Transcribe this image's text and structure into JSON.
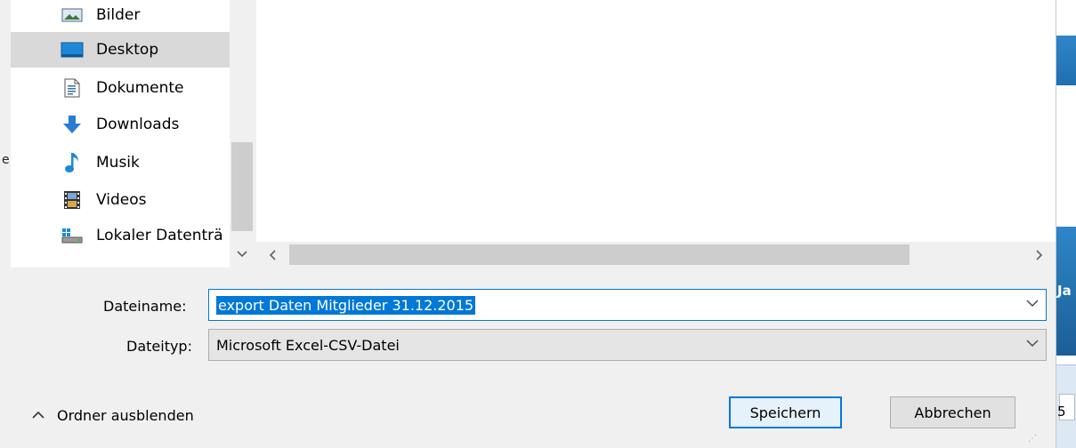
{
  "nav": {
    "items": [
      {
        "label": "Bilder",
        "icon": "pictures-icon"
      },
      {
        "label": "Desktop",
        "icon": "desktop-icon",
        "selected": true
      },
      {
        "label": "Dokumente",
        "icon": "documents-icon"
      },
      {
        "label": "Downloads",
        "icon": "download-arrow-icon"
      },
      {
        "label": "Musik",
        "icon": "music-note-icon"
      },
      {
        "label": "Videos",
        "icon": "film-icon"
      },
      {
        "label": "Lokaler Datenträ",
        "icon": "local-drive-icon"
      }
    ]
  },
  "form": {
    "filename_label": "Dateiname:",
    "filename_value": "export Daten Mitglieder 31.12.2015",
    "filetype_label": "Dateityp:",
    "filetype_value": "Microsoft Excel-CSV-Datei"
  },
  "footer": {
    "hide_folders_label": "Ordner ausblenden",
    "save_label": "Speichern",
    "cancel_label": "Abbrechen"
  },
  "background_window": {
    "heading_fragment": "Ja",
    "cell_fragment": "5"
  },
  "colors": {
    "accent": "#0078d7",
    "selection": "#d9d9d9",
    "window_bg": "#f0f0f0"
  }
}
